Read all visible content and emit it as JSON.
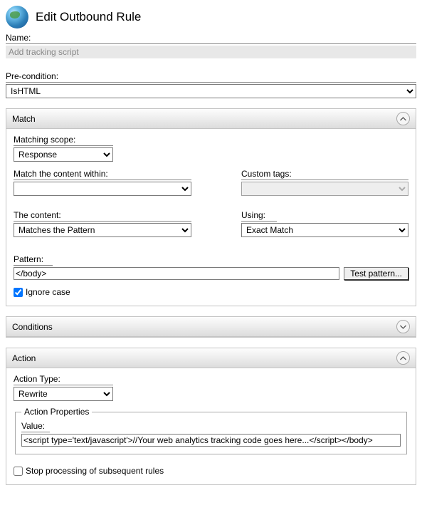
{
  "header": {
    "title": "Edit Outbound Rule"
  },
  "name": {
    "label": "Name:",
    "value": "Add tracking script"
  },
  "precondition": {
    "label": "Pre-condition:",
    "value": "IsHTML"
  },
  "match": {
    "group_title": "Match",
    "matching_scope_label": "Matching scope:",
    "matching_scope_value": "Response",
    "content_within_label": "Match the content within:",
    "content_within_value": "",
    "custom_tags_label": "Custom tags:",
    "custom_tags_value": "",
    "the_content_label": "The content:",
    "the_content_value": "Matches the Pattern",
    "using_label": "Using:",
    "using_value": "Exact Match",
    "pattern_label": "Pattern:",
    "pattern_value": "</body>",
    "test_button": "Test pattern...",
    "ignore_case_label": "Ignore case",
    "ignore_case_checked": true
  },
  "conditions": {
    "group_title": "Conditions"
  },
  "action": {
    "group_title": "Action",
    "type_label": "Action Type:",
    "type_value": "Rewrite",
    "props_legend": "Action Properties",
    "value_label": "Value:",
    "value_text": "<script type='text/javascript'>//Your web analytics tracking code goes here...</script></body>",
    "stop_label": "Stop processing of subsequent rules",
    "stop_checked": false
  }
}
